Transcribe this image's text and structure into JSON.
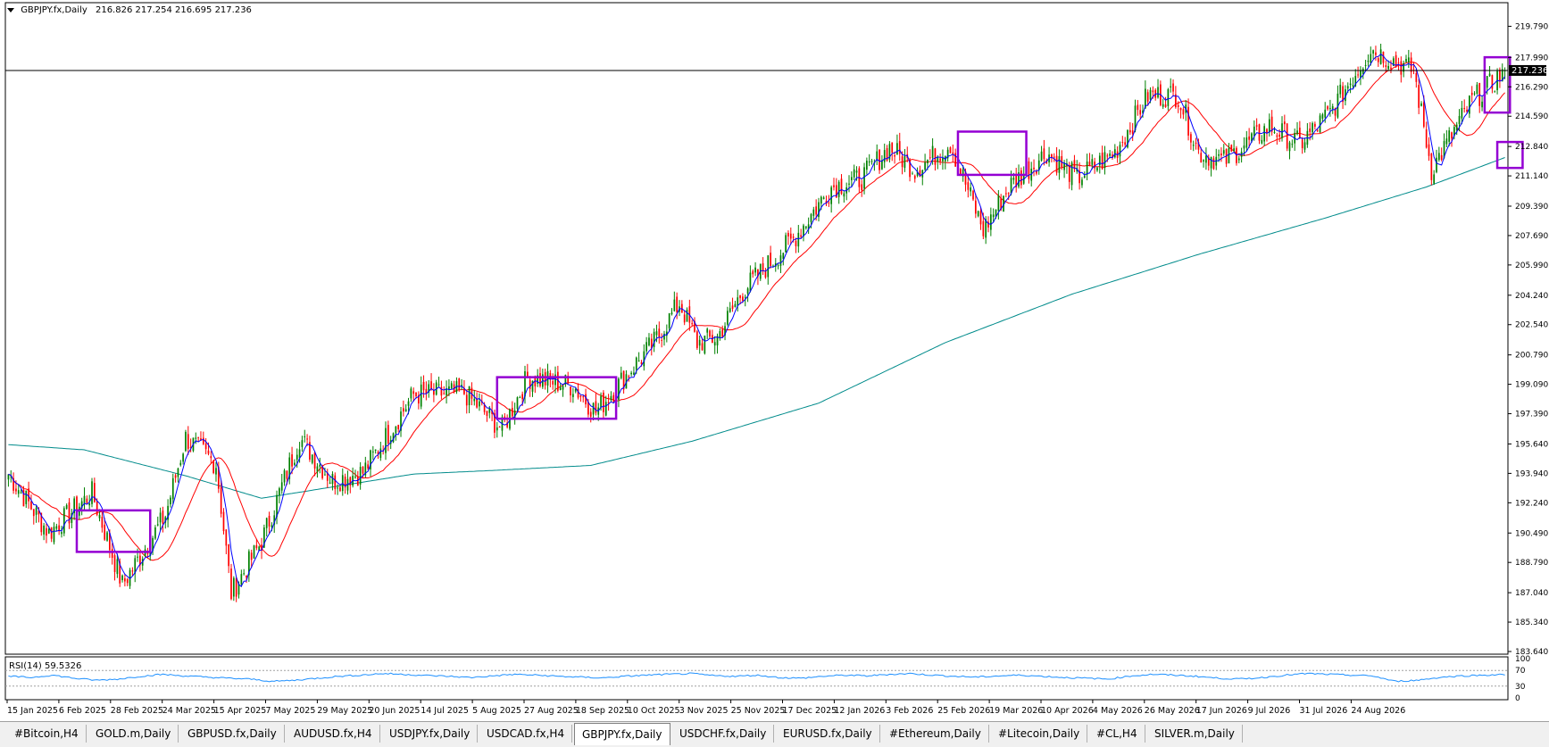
{
  "header": {
    "triangle_icon": "triangle-down-icon",
    "symbol": "GBPJPY.fx,Daily",
    "ohlc": "216.826 217.254 216.695 217.236"
  },
  "rsi": {
    "label": "RSI(14) 59.5326",
    "levels": [
      "100",
      "70",
      "30",
      "0"
    ]
  },
  "colors": {
    "bull": "#008000",
    "bear": "#ff0000",
    "ma_fast": "#0000ff",
    "ma_mid": "#ff0000",
    "ma_slow": "#008b8b",
    "box": "#9400d3",
    "rsi": "#1e90ff",
    "price_tag": "#000000"
  },
  "chart_data": {
    "type": "candlestick",
    "price_scale": [
      "219.790",
      "217.990",
      "216.290",
      "214.590",
      "212.840",
      "211.140",
      "209.390",
      "207.690",
      "205.990",
      "204.240",
      "202.540",
      "200.790",
      "199.090",
      "197.390",
      "195.640",
      "193.940",
      "192.240",
      "190.490",
      "188.790",
      "187.040",
      "185.340",
      "183.640"
    ],
    "current_price": "217.236",
    "x_labels": [
      "15 Jan 2025",
      "6 Feb 2025",
      "28 Feb 2025",
      "24 Mar 2025",
      "15 Apr 2025",
      "7 May 2025",
      "29 May 2025",
      "20 Jun 2025",
      "14 Jul 2025",
      "5 Aug 2025",
      "27 Aug 2025",
      "18 Sep 2025",
      "10 Oct 2025",
      "3 Nov 2025",
      "25 Nov 2025",
      "17 Dec 2025",
      "12 Jan 2026",
      "3 Feb 2026",
      "25 Feb 2026",
      "19 Mar 2026",
      "10 Apr 2026",
      "4 May 2026",
      "26 May 2026",
      "17 Jun 2026",
      "9 Jul 2026",
      "31 Jul 2026",
      "24 Aug 2026"
    ],
    "ylim": [
      183.64,
      221.0
    ],
    "path_points": [
      [
        0,
        193.9
      ],
      [
        16,
        190.5
      ],
      [
        33,
        192.8
      ],
      [
        45,
        187.5
      ],
      [
        62,
        191.5
      ],
      [
        70,
        196.0
      ],
      [
        82,
        194.5
      ],
      [
        88,
        187.0
      ],
      [
        100,
        190.0
      ],
      [
        115,
        196.0
      ],
      [
        128,
        193.5
      ],
      [
        140,
        194.0
      ],
      [
        160,
        198.5
      ],
      [
        180,
        198.6
      ],
      [
        195,
        196.5
      ],
      [
        205,
        199.5
      ],
      [
        223,
        199.0
      ],
      [
        232,
        197.5
      ],
      [
        245,
        199.8
      ],
      [
        255,
        201.5
      ],
      [
        265,
        203.8
      ],
      [
        272,
        201.5
      ],
      [
        280,
        201.8
      ],
      [
        290,
        204.5
      ],
      [
        310,
        207.5
      ],
      [
        325,
        210.5
      ],
      [
        337,
        211.0
      ],
      [
        348,
        212.8
      ],
      [
        358,
        211.5
      ],
      [
        372,
        213.0
      ],
      [
        385,
        208.0
      ],
      [
        395,
        210.5
      ],
      [
        410,
        212.5
      ],
      [
        422,
        211.0
      ],
      [
        437,
        212.5
      ],
      [
        450,
        215.8
      ],
      [
        462,
        215.8
      ],
      [
        470,
        212.5
      ],
      [
        480,
        212.0
      ],
      [
        498,
        214.0
      ],
      [
        510,
        213.0
      ],
      [
        522,
        214.8
      ],
      [
        538,
        218.5
      ],
      [
        555,
        217.2
      ],
      [
        562,
        211.5
      ],
      [
        578,
        215.5
      ],
      [
        586,
        216.5
      ],
      [
        591,
        217.236
      ]
    ],
    "ma_slow_points": [
      [
        0,
        195.6
      ],
      [
        30,
        195.3
      ],
      [
        70,
        193.8
      ],
      [
        100,
        192.5
      ],
      [
        130,
        193.2
      ],
      [
        160,
        193.9
      ],
      [
        190,
        194.1
      ],
      [
        230,
        194.4
      ],
      [
        270,
        195.8
      ],
      [
        320,
        198.0
      ],
      [
        370,
        201.5
      ],
      [
        420,
        204.3
      ],
      [
        470,
        206.6
      ],
      [
        520,
        208.7
      ],
      [
        560,
        210.5
      ],
      [
        591,
        212.2
      ]
    ],
    "rsi_values": [
      55,
      52,
      58,
      50,
      45,
      48,
      55,
      60,
      56,
      53,
      50,
      48,
      42,
      45,
      50,
      55,
      58,
      62,
      60,
      57,
      55,
      52,
      56,
      60,
      58,
      55,
      53,
      51,
      55,
      58,
      60,
      62,
      57,
      55,
      58,
      52,
      50,
      55,
      58,
      56,
      60,
      62,
      58,
      55,
      53,
      56,
      58,
      55,
      52,
      50,
      48,
      56,
      60,
      58,
      55,
      50,
      48,
      52,
      58,
      62,
      60,
      58,
      56,
      42,
      45,
      52,
      56,
      58,
      59.5
    ],
    "boxes": [
      {
        "label": "",
        "t0": 27,
        "t1": 56,
        "p0": 189.4,
        "p1": 191.8
      },
      {
        "label": "",
        "t0": 193,
        "t1": 240,
        "p0": 197.1,
        "p1": 199.5
      },
      {
        "label": "",
        "t0": 375,
        "t1": 402,
        "p0": 211.2,
        "p1": 213.7
      },
      {
        "label": "",
        "t0": 583,
        "t1": 593,
        "p0": 214.8,
        "p1": 218.0
      },
      {
        "label": "",
        "t0": 588,
        "t1": 598,
        "p0": 211.6,
        "p1": 213.1
      }
    ]
  },
  "tabs": [
    {
      "label": "#Bitcoin,H4",
      "active": false
    },
    {
      "label": "GOLD.m,Daily",
      "active": false
    },
    {
      "label": "GBPUSD.fx,Daily",
      "active": false
    },
    {
      "label": "AUDUSD.fx,H4",
      "active": false
    },
    {
      "label": "USDJPY.fx,Daily",
      "active": false
    },
    {
      "label": "USDCAD.fx,H4",
      "active": false
    },
    {
      "label": "GBPJPY.fx,Daily",
      "active": true
    },
    {
      "label": "USDCHF.fx,Daily",
      "active": false
    },
    {
      "label": "EURUSD.fx,Daily",
      "active": false
    },
    {
      "label": "#Ethereum,Daily",
      "active": false
    },
    {
      "label": "#Litecoin,Daily",
      "active": false
    },
    {
      "label": "#CL,H4",
      "active": false
    },
    {
      "label": "SILVER.m,Daily",
      "active": false
    }
  ]
}
